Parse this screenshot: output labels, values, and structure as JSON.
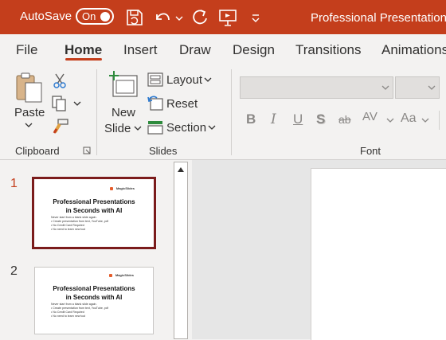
{
  "titlebar": {
    "autosave_label": "AutoSave",
    "autosave_state": "On",
    "document_title": "Professional Presentations",
    "icons": [
      "save-icon",
      "undo-icon",
      "redo-icon",
      "present-icon",
      "customize-qat-icon"
    ]
  },
  "tabs": [
    {
      "label": "File"
    },
    {
      "label": "Home",
      "active": true
    },
    {
      "label": "Insert"
    },
    {
      "label": "Draw"
    },
    {
      "label": "Design"
    },
    {
      "label": "Transitions"
    },
    {
      "label": "Animations"
    }
  ],
  "ribbon": {
    "clipboard": {
      "paste_label": "Paste",
      "group_label": "Clipboard"
    },
    "slides": {
      "new_slide_line1": "New",
      "new_slide_line2": "Slide",
      "layout_label": "Layout",
      "reset_label": "Reset",
      "section_label": "Section",
      "group_label": "Slides"
    },
    "font": {
      "font_name_value": "",
      "font_size_value": "",
      "group_label": "Font",
      "buttons": [
        "B",
        "I",
        "U",
        "S",
        "ab",
        "AV",
        "Aa"
      ]
    }
  },
  "slides": [
    {
      "number": "1",
      "selected": true,
      "logo": "MagicSlides",
      "title_line1": "Professional Presentations",
      "title_line2": "in Seconds with AI",
      "bullets": [
        "Never start from a blank slide again.",
        "• Create presentation from text, YouTube, pdf",
        "• No Credit Card Required",
        "• No need to learn new tool"
      ]
    },
    {
      "number": "2",
      "selected": false,
      "logo": "MagicSlides",
      "title_line1": "Professional Presentations",
      "title_line2": "in Seconds with AI",
      "bullets": [
        "Never start from a blank slide again.",
        "• Create presentation from text, YouTube, pdf",
        "• No Credit Card Required",
        "• No need to learn new tool"
      ]
    }
  ],
  "colors": {
    "accent": "#c43e1c",
    "selected_border": "#7b1c1c"
  }
}
